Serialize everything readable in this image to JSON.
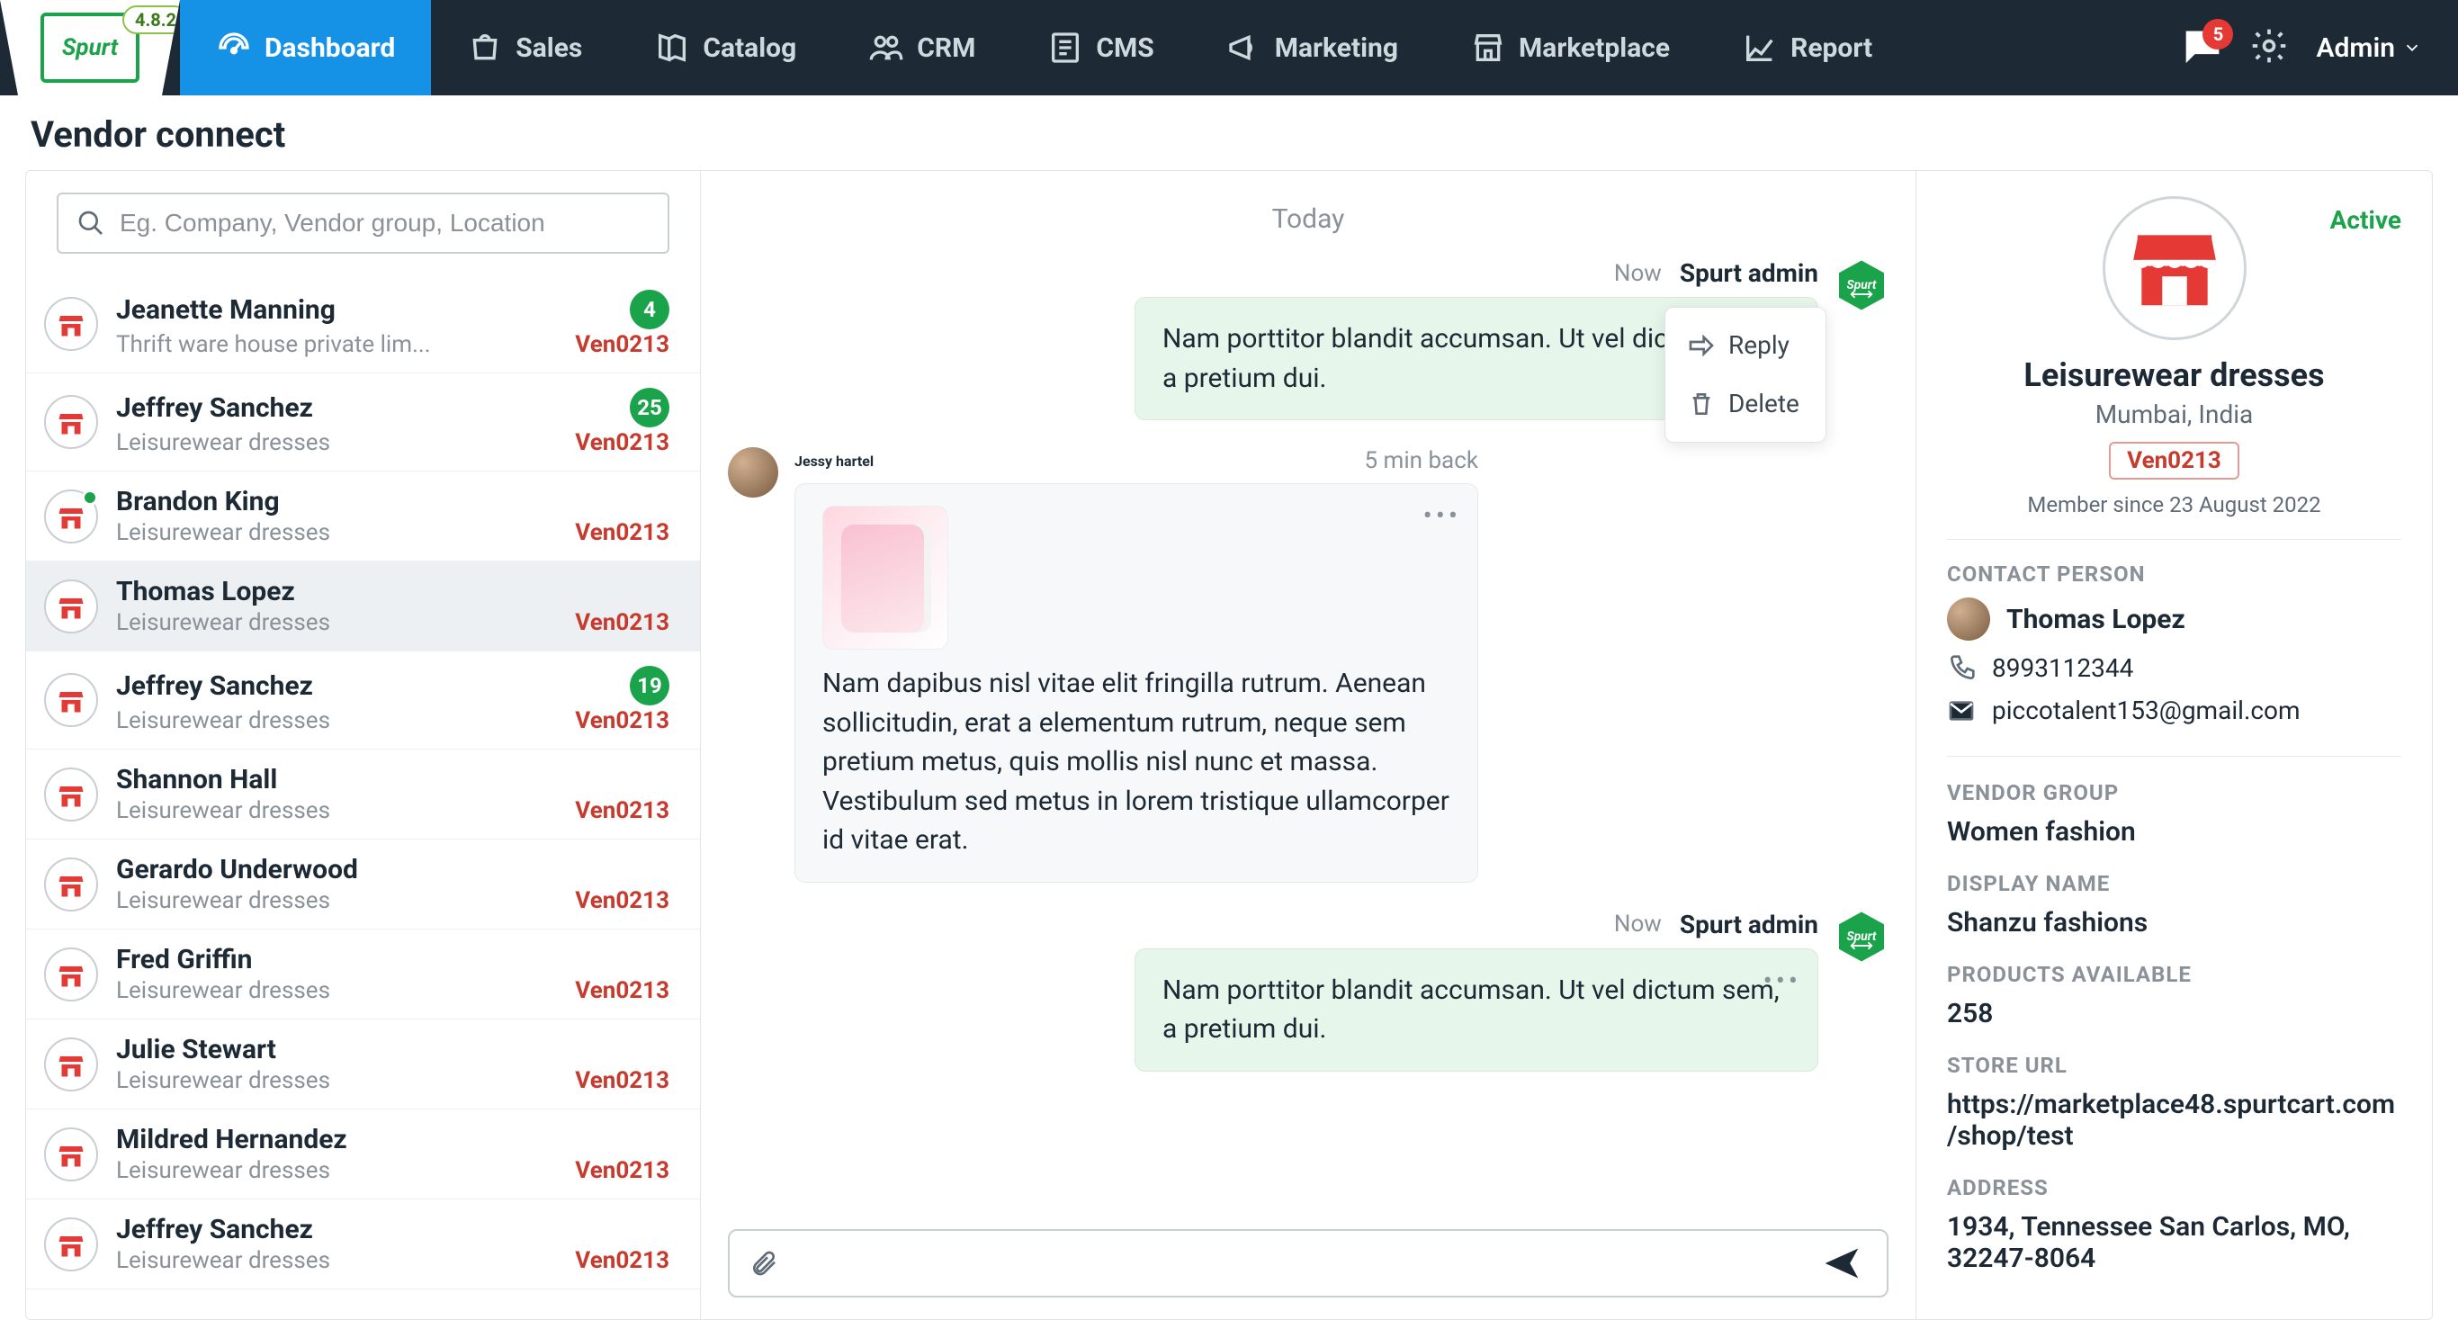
{
  "app": {
    "version": "4.8.2",
    "logo_text": "Spurt",
    "admin_label": "Admin",
    "notif_count": "5"
  },
  "nav": [
    {
      "key": "dashboard",
      "label": "Dashboard",
      "active": true
    },
    {
      "key": "sales",
      "label": "Sales"
    },
    {
      "key": "catalog",
      "label": "Catalog"
    },
    {
      "key": "crm",
      "label": "CRM"
    },
    {
      "key": "cms",
      "label": "CMS"
    },
    {
      "key": "marketing",
      "label": "Marketing"
    },
    {
      "key": "marketplace",
      "label": "Marketplace"
    },
    {
      "key": "report",
      "label": "Report"
    }
  ],
  "page": {
    "title": "Vendor connect"
  },
  "search": {
    "placeholder": "Eg. Company, Vendor group, Location"
  },
  "vendors": [
    {
      "name": "Jeanette Manning",
      "company": "Thrift ware house private lim...",
      "id": "Ven0213",
      "badge": "4"
    },
    {
      "name": "Jeffrey Sanchez",
      "company": "Leisurewear dresses",
      "id": "Ven0213",
      "badge": "25"
    },
    {
      "name": "Brandon King",
      "company": "Leisurewear dresses",
      "id": "Ven0213",
      "online": true
    },
    {
      "name": "Thomas Lopez",
      "company": "Leisurewear dresses",
      "id": "Ven0213",
      "selected": true
    },
    {
      "name": "Jeffrey Sanchez",
      "company": "Leisurewear dresses",
      "id": "Ven0213",
      "badge": "19"
    },
    {
      "name": "Shannon Hall",
      "company": "Leisurewear dresses",
      "id": "Ven0213"
    },
    {
      "name": "Gerardo Underwood",
      "company": "Leisurewear dresses",
      "id": "Ven0213"
    },
    {
      "name": "Fred Griffin",
      "company": "Leisurewear dresses",
      "id": "Ven0213"
    },
    {
      "name": "Julie Stewart",
      "company": "Leisurewear dresses",
      "id": "Ven0213"
    },
    {
      "name": "Mildred Hernandez",
      "company": "Leisurewear dresses",
      "id": "Ven0213"
    },
    {
      "name": "Jeffrey Sanchez",
      "company": "Leisurewear dresses",
      "id": "Ven0213"
    }
  ],
  "chat": {
    "day_label": "Today",
    "popover": {
      "reply": "Reply",
      "delete": "Delete"
    },
    "messages": [
      {
        "dir": "out",
        "sender": "Spurt admin",
        "time": "Now",
        "text": "Nam porttitor blandit accumsan. Ut vel dictum sem, a pretium dui.",
        "more": true,
        "popover": true,
        "truncated": "Nam porttitor blandit accumsan. Ut vel d\nsem, a pretium dui."
      },
      {
        "dir": "in",
        "sender": "Jessy hartel",
        "time": "5 min back",
        "image": true,
        "text": "Nam dapibus nisl vitae elit fringilla rutrum. Aenean sollicitudin, erat a elementum rutrum, neque sem pretium metus, quis mollis nisl nunc et massa. Vestibulum sed metus in lorem tristique ullamcorper id vitae erat.",
        "more": true
      },
      {
        "dir": "out",
        "sender": "Spurt admin",
        "time": "Now",
        "text": "Nam porttitor blandit accumsan. Ut vel dictum sem, a pretium dui.",
        "more": true
      }
    ]
  },
  "info": {
    "status": "Active",
    "title": "Leisurewear dresses",
    "location": "Mumbai, India",
    "id": "Ven0213",
    "member_since": "Member since 23 August 2022",
    "contact_label": "CONTACT PERSON",
    "contact_name": "Thomas Lopez",
    "contact_phone": "8993112344",
    "contact_email": "piccotalent153@gmail.com",
    "vendor_group_label": "VENDOR GROUP",
    "vendor_group": "Women fashion",
    "display_name_label": "DISPLAY NAME",
    "display_name": "Shanzu fashions",
    "products_label": "PRODUCTS AVAILABLE",
    "products": "258",
    "store_url_label": "STORE URL",
    "store_url": "https://marketplace48.spurtcart.com/shop/test",
    "address_label": "ADDRESS",
    "address": "1934, Tennessee San Carlos, MO, 32247-8064"
  }
}
